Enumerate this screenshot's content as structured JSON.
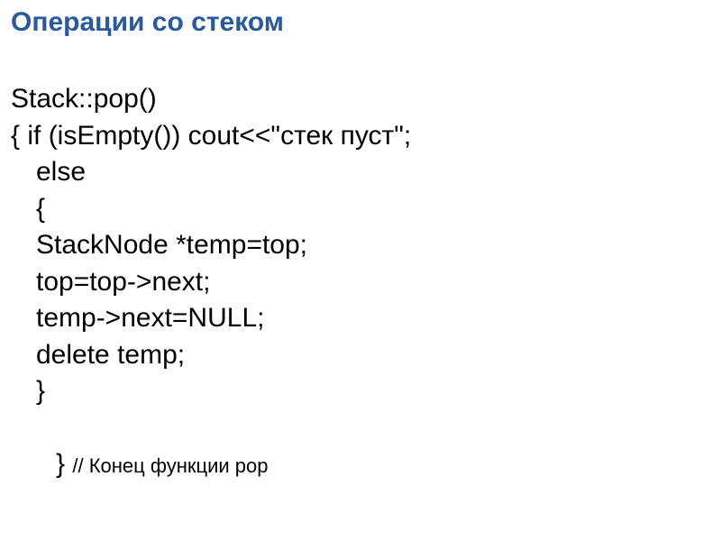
{
  "title": "Операции со стеком",
  "code": {
    "l1": "Stack::pop()",
    "l2": "{ if (isEmpty()) cout<<\"стек пуст\";",
    "l3": "else",
    "l4": "{",
    "l5": "StackNode *temp=top;",
    "l6": "top=top->next;",
    "l7": "temp->next=NULL;",
    "l8": "delete temp;",
    "l9": "}",
    "l10_brace": "} ",
    "l10_comment": "// Конец функции pop"
  }
}
